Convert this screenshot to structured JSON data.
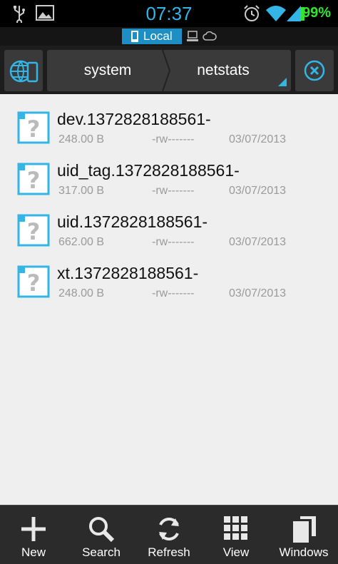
{
  "status_bar": {
    "time": "07:37",
    "battery": "99%",
    "icons": [
      "usb-icon",
      "image-icon",
      "alarm-icon",
      "wifi-icon",
      "signal-icon",
      "battery-icon"
    ]
  },
  "tabs": {
    "active_label": "Local",
    "icons": [
      "phone-icon",
      "network-computer-icon",
      "cloud-icon"
    ]
  },
  "path_bar": {
    "crumbs": [
      "system",
      "netstats"
    ]
  },
  "files": [
    {
      "name": "dev.1372828188561-",
      "size": "248.00 B",
      "perms": "-rw-------",
      "date": "03/07/2013"
    },
    {
      "name": "uid_tag.1372828188561-",
      "size": "317.00 B",
      "perms": "-rw-------",
      "date": "03/07/2013"
    },
    {
      "name": "uid.1372828188561-",
      "size": "662.00 B",
      "perms": "-rw-------",
      "date": "03/07/2013"
    },
    {
      "name": "xt.1372828188561-",
      "size": "248.00 B",
      "perms": "-rw-------",
      "date": "03/07/2013"
    }
  ],
  "bottom_bar": {
    "new": "New",
    "search": "Search",
    "refresh": "Refresh",
    "view": "View",
    "windows": "Windows"
  },
  "colors": {
    "accent": "#33b5e5",
    "battery": "#33e533",
    "tab_active": "#1e8fc4"
  }
}
